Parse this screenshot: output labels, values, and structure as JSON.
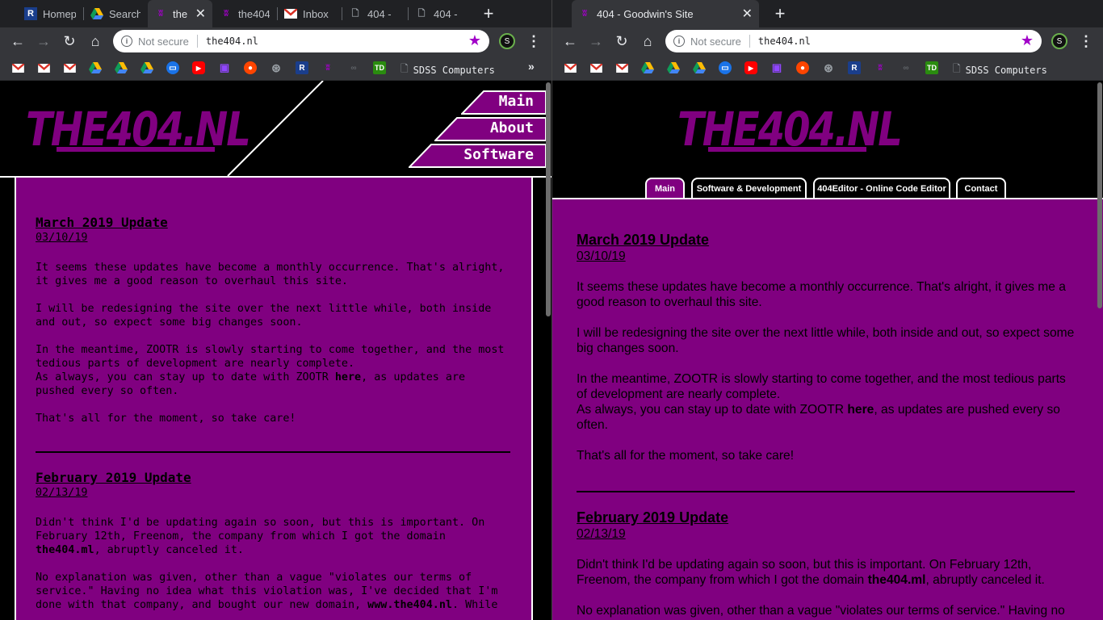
{
  "left": {
    "tabs": [
      {
        "label": "Homepa",
        "icon": "R"
      },
      {
        "label": "Search",
        "icon": "drive"
      },
      {
        "label": "the",
        "icon": "404"
      },
      {
        "label": "the404",
        "icon": "404"
      },
      {
        "label": "Inbox",
        "icon": "gmail"
      },
      {
        "label": "404 -",
        "icon": "page"
      },
      {
        "label": "404 -",
        "icon": "page"
      }
    ],
    "omnibox": {
      "security": "Not secure",
      "url": "the404.nl"
    },
    "bookmarks": {
      "text_item": "SDSS Computers",
      "more": "»"
    },
    "nav": [
      "Main",
      "About",
      "Software"
    ],
    "posts": [
      {
        "title": "March 2019 Update",
        "date": "03/10/19",
        "p1": "It seems these updates have become a monthly occurrence. That's alright, it gives me a good reason to overhaul this site.",
        "p2": "I will be redesigning the site over the next little while, both inside and out, so expect some big changes soon.",
        "p3": "In the meantime, ZOOTR is slowly starting to come together, and the most tedious parts of development are nearly complete.",
        "p4a": "As always, you can stay up to date with ZOOTR ",
        "p4link": "here",
        "p4b": ", as updates are pushed every so often.",
        "p5": "That's all for the moment, so take care!"
      },
      {
        "title": "February 2019 Update",
        "date": "02/13/19",
        "p1a": "Didn't think I'd be updating again so soon, but this is important. On February 12th, Freenom, the company from which I got the domain ",
        "p1link": "the404.ml",
        "p1b": ", abruptly canceled it.",
        "p2a": "No explanation was given, other than a vague \"violates our terms of service.\" Having no idea what this violation was, I've decided that I'm done with that company, and bought our new domain, ",
        "p2link": "www.the404.nl",
        "p2b": ". While"
      }
    ]
  },
  "right": {
    "tab": {
      "label": "404 - Goodwin's Site"
    },
    "omnibox": {
      "security": "Not secure",
      "url": "the404.nl"
    },
    "bookmarks": {
      "text_item": "SDSS Computers"
    },
    "nav": [
      "Main",
      "Software & Development",
      "404Editor - Online Code Editor",
      "Contact"
    ],
    "posts": [
      {
        "title": "March 2019 Update",
        "date": "03/10/19",
        "p1": "It seems these updates have become a monthly occurrence. That's alright, it gives me a good reason to overhaul this site.",
        "p2": "I will be redesigning the site over the next little while, both inside and out, so expect some big changes soon.",
        "p3": "In the meantime, ZOOTR is slowly starting to come together, and the most tedious parts of development are nearly complete.",
        "p4a": "As always, you can stay up to date with ZOOTR ",
        "p4link": "here",
        "p4b": ", as updates are pushed every so often.",
        "p5": "That's all for the moment, so take care!"
      },
      {
        "title": "February 2019 Update",
        "date": "02/13/19",
        "p1a": "Didn't think I'd be updating again so soon, but this is important. On February 12th, Freenom, the company from which I got the domain ",
        "p1link": "the404.ml",
        "p1b": ", abruptly canceled it.",
        "p2": "No explanation was given, other than a vague \"violates our terms of service.\" Having no"
      }
    ]
  },
  "logo_text": "THE404.NL",
  "colors": {
    "brand_purple": "#800080",
    "star": "#a100c8"
  }
}
